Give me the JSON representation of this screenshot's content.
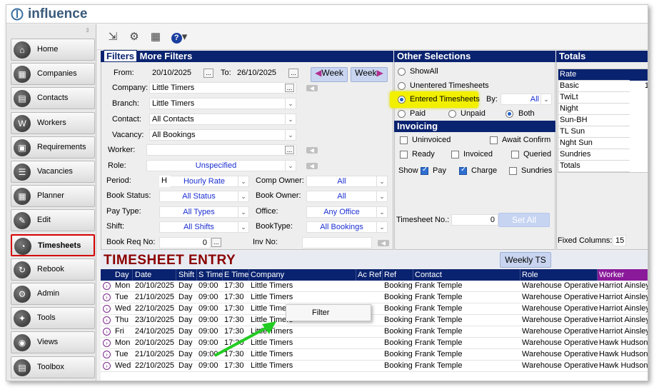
{
  "app": {
    "logo_text": "influence"
  },
  "sidebar": {
    "items": [
      {
        "label": "Home",
        "icon": "home-icon"
      },
      {
        "label": "Companies",
        "icon": "companies-icon"
      },
      {
        "label": "Contacts",
        "icon": "contacts-icon"
      },
      {
        "label": "Workers",
        "icon": "workers-icon"
      },
      {
        "label": "Requirements",
        "icon": "requirements-icon"
      },
      {
        "label": "Vacancies",
        "icon": "vacancies-icon"
      },
      {
        "label": "Planner",
        "icon": "planner-icon"
      },
      {
        "label": "Edit",
        "icon": "edit-icon"
      },
      {
        "label": "Timesheets",
        "icon": "timesheets-icon",
        "active": true
      },
      {
        "label": "Rebook",
        "icon": "rebook-icon"
      },
      {
        "label": "Admin",
        "icon": "admin-icon"
      },
      {
        "label": "Tools",
        "icon": "tools-icon"
      },
      {
        "label": "Views",
        "icon": "views-icon"
      },
      {
        "label": "Toolbox",
        "icon": "toolbox-icon"
      }
    ]
  },
  "filters": {
    "tab_filters": "Filters",
    "tab_more": "More Filters",
    "from_label": "From:",
    "from_value": "20/10/2025",
    "to_label": "To:",
    "to_value": "26/10/2025",
    "week_prev": "Week",
    "week_next": "Week",
    "company_label": "Company:",
    "company_value": "Little Timers",
    "branch_label": "Branch:",
    "branch_value": "Little Timers",
    "contact_label": "Contact:",
    "contact_value": "All Contacts",
    "vacancy_label": "Vacancy:",
    "vacancy_value": "All Bookings",
    "worker_label": "Worker:",
    "worker_value": "",
    "role_label": "Role:",
    "role_value": "Unspecified",
    "period_label": "Period:",
    "period_code": "H",
    "period_value": "Hourly Rate",
    "comp_owner_label": "Comp Owner:",
    "comp_owner_value": "All",
    "book_status_label": "Book Status:",
    "book_status_value": "All Status",
    "book_owner_label": "Book Owner:",
    "book_owner_value": "All",
    "pay_type_label": "Pay Type:",
    "pay_type_value": "All Types",
    "office_label": "Office:",
    "office_value": "Any Office",
    "shift_label": "Shift:",
    "shift_value": "All Shifts",
    "booktype_label": "BookType:",
    "booktype_value": "All Bookings",
    "book_req_label": "Book Req No:",
    "book_req_value": "0",
    "inv_no_label": "Inv No:",
    "inv_no_value": ""
  },
  "other_selections": {
    "title": "Other Selections",
    "show_all": "ShowAll",
    "unentered": "Unentered Timesheets",
    "entered": "Entered Timesheets",
    "by_label": "By:",
    "by_value": "All",
    "paid": "Paid",
    "unpaid": "Unpaid",
    "both": "Both"
  },
  "invoicing": {
    "title": "Invoicing",
    "uninvoiced": "Uninvoiced",
    "await_confirm": "Await Confirm",
    "ready": "Ready",
    "invoiced": "Invoiced",
    "queried": "Queried",
    "show_label": "Show",
    "pay": "Pay",
    "charge": "Charge",
    "sundries": "Sundries",
    "timesheet_no_label": "Timesheet No.:",
    "timesheet_no_value": "0",
    "set_all": "Set All"
  },
  "totals": {
    "title": "Totals",
    "rows": [
      "Rate",
      "Basic",
      "TwiLt",
      "Night",
      "Sun-BH",
      "TL Sun",
      "Nght Sun",
      "Sundries",
      "Totals"
    ],
    "basic_partial": "1",
    "fixed_columns_label": "Fixed Columns:",
    "fixed_columns_value": "15"
  },
  "entry": {
    "title": "TIMESHEET ENTRY",
    "weekly_ts": "Weekly TS"
  },
  "grid": {
    "headers": [
      "Day",
      "Date",
      "Shift",
      "S Time",
      "E Time",
      "Company",
      "Ac Ref",
      "Ref",
      "Contact",
      "Role",
      "Worker"
    ],
    "rows": [
      [
        "Mon",
        "20/10/2025",
        "Day",
        "09:00",
        "17:30",
        "Little Timers",
        "",
        "Booking",
        "Frank Temple",
        "Warehouse Operative",
        "Harriot Ainsley"
      ],
      [
        "Tue",
        "21/10/2025",
        "Day",
        "09:00",
        "17:30",
        "Little Timers",
        "",
        "Booking",
        "Frank Temple",
        "Warehouse Operative",
        "Harriot Ainsley"
      ],
      [
        "Wed",
        "22/10/2025",
        "Day",
        "09:00",
        "17:30",
        "Little Timers",
        "",
        "Booking",
        "Frank Temple",
        "Warehouse Operative",
        "Harriot Ainsley"
      ],
      [
        "Thu",
        "23/10/2025",
        "Day",
        "09:00",
        "17:30",
        "Little Timers",
        "",
        "Booking",
        "Frank Temple",
        "Warehouse Operative",
        "Harriot Ainsley"
      ],
      [
        "Fri",
        "24/10/2025",
        "Day",
        "09:00",
        "17:30",
        "Little Timers",
        "",
        "Booking",
        "Frank Temple",
        "Warehouse Operative",
        "Harriot Ainsley"
      ],
      [
        "Mon",
        "20/10/2025",
        "Day",
        "09:00",
        "17:30",
        "Little Timers",
        "",
        "Booking",
        "Frank Temple",
        "Warehouse Operative",
        "Hawk Hudson"
      ],
      [
        "Tue",
        "21/10/2025",
        "Day",
        "09:00",
        "17:30",
        "Little Timers",
        "",
        "Booking",
        "Frank Temple",
        "Warehouse Operative",
        "Hawk Hudson"
      ],
      [
        "Wed",
        "22/10/2025",
        "Day",
        "09:00",
        "17:30",
        "Little Timers",
        "",
        "Booking",
        "Frank Temple",
        "Warehouse Operative",
        "Hawk Hudson"
      ]
    ]
  },
  "context_menu": {
    "item": "Filter"
  },
  "colors": {
    "header_navy": "#0a2370",
    "highlight_yellow": "#f2f000",
    "active_red": "#d40000",
    "entry_title": "#8b0000",
    "arrow_green": "#22cc22",
    "worker_header": "#8a1a9a"
  }
}
